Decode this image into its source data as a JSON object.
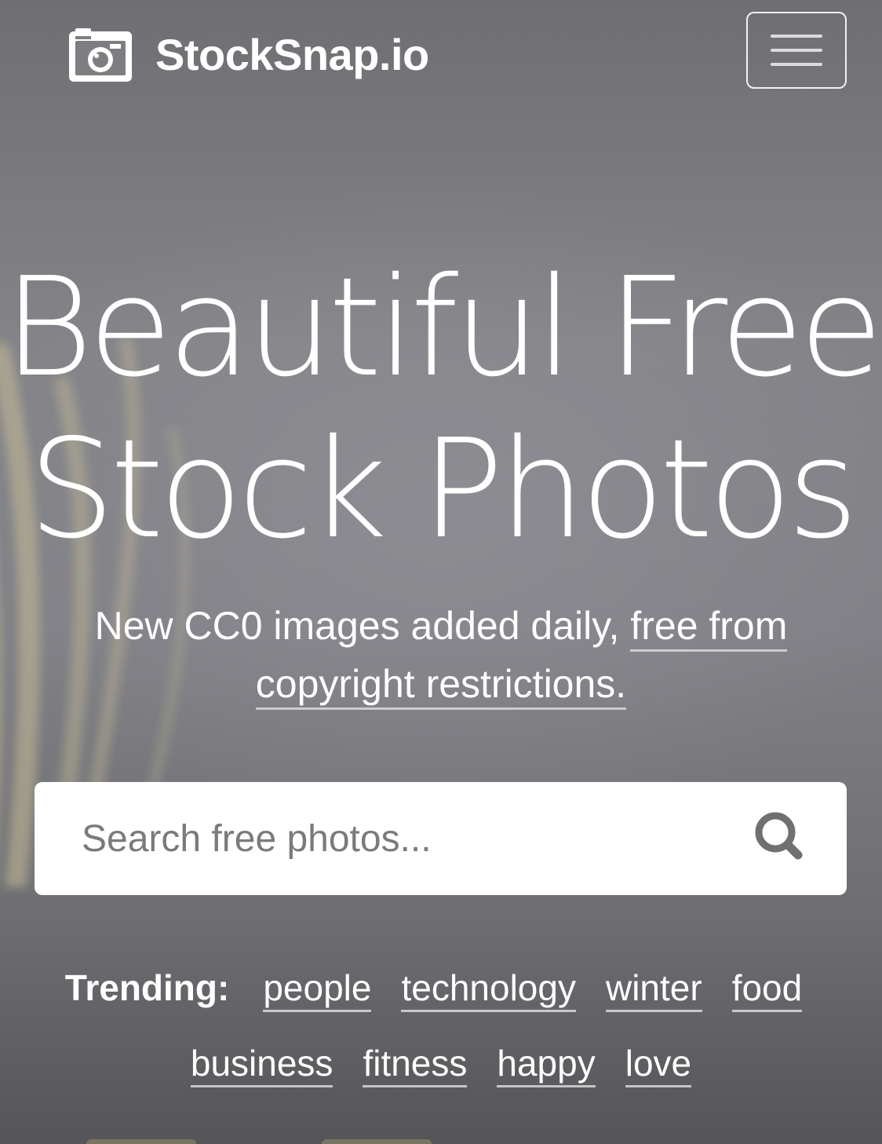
{
  "header": {
    "brand_name": "StockSnap.io",
    "brand_icon": "camera-icon",
    "menu_icon": "hamburger-menu-icon"
  },
  "hero": {
    "headline_line1": "Beautiful Free",
    "headline_line2": "Stock Photos",
    "subtitle_prefix": "New CC0 images added daily, ",
    "subtitle_link": "free from copyright restrictions."
  },
  "search": {
    "placeholder": "Search free photos...",
    "value": "",
    "button_icon": "search-icon"
  },
  "trending": {
    "label": "Trending:",
    "tags": [
      "people",
      "technology",
      "winter",
      "food",
      "business",
      "fitness",
      "happy",
      "love"
    ]
  },
  "colors": {
    "background": "#808086",
    "text": "#ffffff",
    "search_bg": "#ffffff",
    "placeholder": "#7a7a7a",
    "icon_gray": "#707070"
  }
}
